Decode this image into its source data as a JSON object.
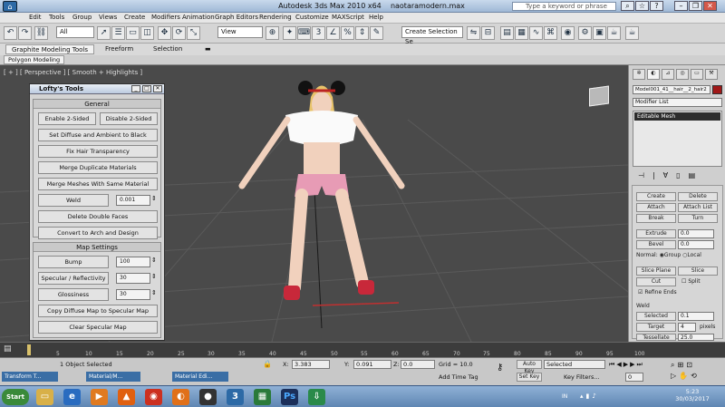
{
  "window": {
    "app_title": "Autodesk 3ds Max 2010 x64",
    "file_name": "naotaramodern.max",
    "help_search_placeholder": "Type a keyword or phrase"
  },
  "menu": [
    "Edit",
    "Tools",
    "Group",
    "Views",
    "Create",
    "Modifiers",
    "Animation",
    "Graph Editors",
    "Rendering",
    "Customize",
    "MAXScript",
    "Help"
  ],
  "toolbar": {
    "selection_filter": "All",
    "ref_coord": "View",
    "named_selection": "Create Selection Se"
  },
  "ribbon": {
    "tabs": [
      "Graphite Modeling Tools",
      "Freeform",
      "Selection"
    ],
    "sub_tab": "Polygon Modeling"
  },
  "viewport": {
    "label": "[ + ] [ Perspective ] [ Smooth + Highlights ]"
  },
  "lofty": {
    "title": "Lofty's Tools",
    "general_header": "General",
    "enable_2sided": "Enable 2-Sided",
    "disable_2sided": "Disable 2-Sided",
    "set_diffuse": "Set Diffuse and Ambient to Black",
    "fix_hair": "Fix Hair Transparency",
    "merge_materials": "Merge Duplicate Materials",
    "merge_meshes": "Merge Meshes With Same Material",
    "weld_label": "Weld",
    "weld_value": "0.001",
    "delete_faces": "Delete Double Faces",
    "convert": "Convert to Arch and Design",
    "map_header": "Map Settings",
    "bump_label": "Bump",
    "bump_value": "100",
    "specular_label": "Specular / Reflectivity",
    "specular_value": "30",
    "gloss_label": "Glossiness",
    "gloss_value": "30",
    "copy_diffuse": "Copy Diffuse Map to Specular Map",
    "clear_specular": "Clear Specular Map"
  },
  "cmdpanel": {
    "object_name": "Model001_41__hair__2_hair2",
    "modifier_list": "Modifier List",
    "stack_item": "Editable Mesh",
    "create_label": "Create",
    "delete_label": "Delete",
    "attach": "Attach",
    "attach_list": "Attach List",
    "break": "Break",
    "turn": "Turn",
    "extrude": "Extrude",
    "extrude_value": "0.0",
    "bevel": "Bevel",
    "bevel_value": "0.0",
    "normal": "Normal:",
    "group": "Group",
    "local": "Local",
    "slice_plane": "Slice Plane",
    "slice": "Slice",
    "cut": "Cut",
    "split": "Split",
    "refine_ends": "Refine Ends",
    "weld_header": "Weld",
    "selected": "Selected",
    "selected_value": "0.1",
    "target": "Target",
    "target_value": "4",
    "pixels": "pixels",
    "tessellate": "Tessellate",
    "tessellate_value": "25.0"
  },
  "timeline": {
    "position": "0 / 100",
    "ticks": [
      "5",
      "10",
      "15",
      "20",
      "25",
      "30",
      "35",
      "40",
      "45",
      "50",
      "55",
      "60",
      "65",
      "70",
      "75",
      "80",
      "85",
      "90",
      "95",
      "100"
    ]
  },
  "status": {
    "selection": "1 Object Selected",
    "x_label": "X:",
    "x_value": "3.383",
    "y_label": "Y:",
    "y_value": "0.091",
    "z_label": "Z:",
    "z_value": "0.0",
    "grid": "Grid = 10.0",
    "add_time_tag": "Add Time Tag",
    "auto_key": "Auto Key",
    "set_key": "Set Key",
    "key_mode": "Selected",
    "key_filters": "Key Filters...",
    "frame": "0",
    "tasks": [
      "Transform T...",
      "Material/M...",
      "Material Edi..."
    ]
  },
  "taskbar": {
    "start": "Start",
    "lang": "IN",
    "time": "5:23",
    "date": "30/03/2017"
  },
  "colors": {
    "viewport_bg": "#4a4a4a",
    "panel_bg": "#d4d4d4",
    "taskbar": "#6f94c0",
    "accent_red": "#c03030"
  }
}
